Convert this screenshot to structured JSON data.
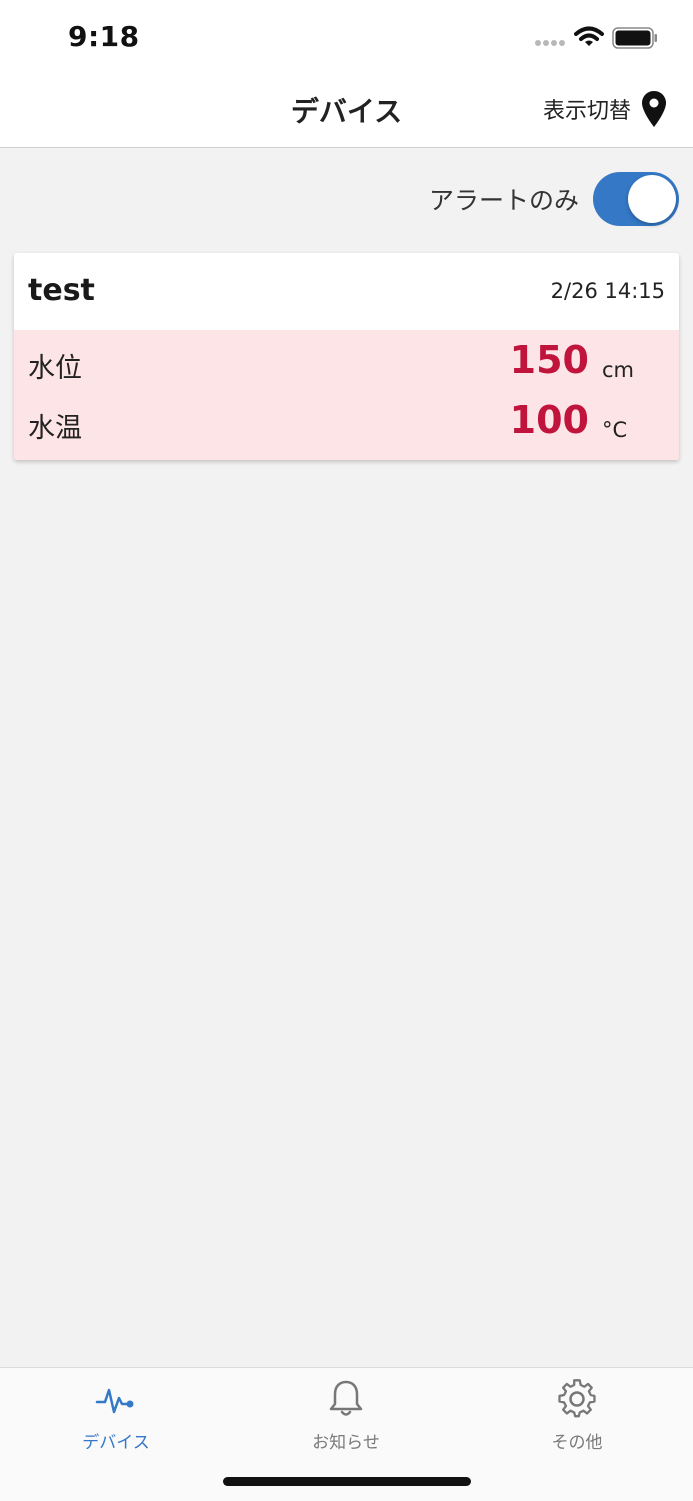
{
  "status_bar": {
    "time": "9:18",
    "signal_icon": "signal-icon",
    "wifi_icon": "wifi-icon",
    "battery_icon": "battery-icon"
  },
  "nav": {
    "title": "デバイス",
    "view_toggle_label": "表示切替",
    "view_toggle_icon": "map-pin-icon"
  },
  "filter": {
    "label": "アラートのみ",
    "enabled": true
  },
  "devices": [
    {
      "name": "test",
      "timestamp": "2/26 14:15",
      "readings": [
        {
          "label": "水位",
          "value": "150",
          "unit": "cm"
        },
        {
          "label": "水温",
          "value": "100",
          "unit": "°C"
        }
      ]
    }
  ],
  "tabs": [
    {
      "label": "デバイス",
      "icon": "pulse-icon",
      "active": true
    },
    {
      "label": "お知らせ",
      "icon": "bell-icon",
      "active": false
    },
    {
      "label": "その他",
      "icon": "gear-icon",
      "active": false
    }
  ],
  "colors": {
    "accent": "#3478c6",
    "alert_background": "#fde4e6",
    "alert_value": "#c0143c"
  }
}
